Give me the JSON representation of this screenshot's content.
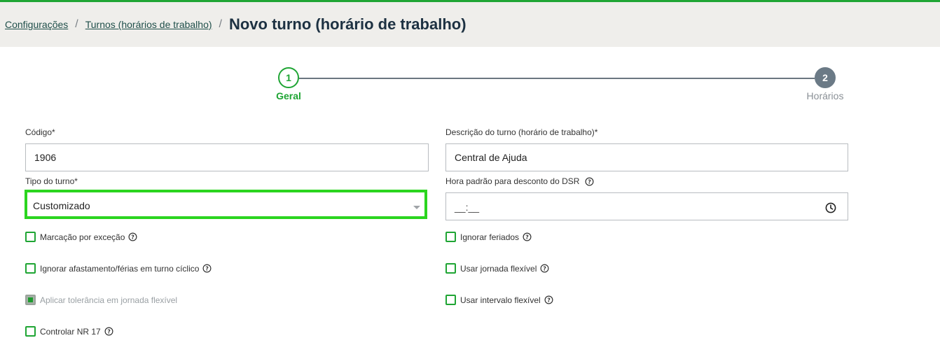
{
  "breadcrumb": {
    "items": [
      "Configurações",
      "Turnos (horários de trabalho)"
    ],
    "separator": "/",
    "current": "Novo turno (horário de trabalho)"
  },
  "stepper": {
    "steps": [
      {
        "number": "1",
        "label": "Geral",
        "state": "active"
      },
      {
        "number": "2",
        "label": "Horários",
        "state": "inactive"
      }
    ]
  },
  "form": {
    "codigo": {
      "label": "Código*",
      "value": "1906"
    },
    "descricao": {
      "label": "Descrição do turno (horário de trabalho)*",
      "value": "Central de Ajuda"
    },
    "tipo": {
      "label": "Tipo do turno*",
      "value": "Customizado"
    },
    "hora_dsr": {
      "label": "Hora padrão para desconto do DSR",
      "value": "__:__"
    }
  },
  "checkboxes_left": [
    {
      "label": "Marcação por exceção",
      "checked": false,
      "disabled": false,
      "help": true
    },
    {
      "label": "Ignorar afastamento/férias em turno cíclico",
      "checked": false,
      "disabled": false,
      "help": true
    },
    {
      "label": "Aplicar tolerância em jornada flexível",
      "checked": true,
      "disabled": true,
      "help": false
    },
    {
      "label": "Controlar NR 17",
      "checked": false,
      "disabled": false,
      "help": true
    }
  ],
  "checkboxes_right": [
    {
      "label": "Ignorar feriados",
      "checked": false,
      "disabled": false,
      "help": true
    },
    {
      "label": "Usar jornada flexível",
      "checked": false,
      "disabled": false,
      "help": true
    },
    {
      "label": "Usar intervalo flexível",
      "checked": false,
      "disabled": false,
      "help": true
    }
  ],
  "colors": {
    "accent": "#1fa534",
    "highlight": "#2bd51f",
    "header_bg": "#efeeeb",
    "step_inactive": "#6b7a86"
  },
  "icons": {
    "help": "question-circle-icon",
    "clock": "clock-icon",
    "caret": "caret-down-icon"
  }
}
